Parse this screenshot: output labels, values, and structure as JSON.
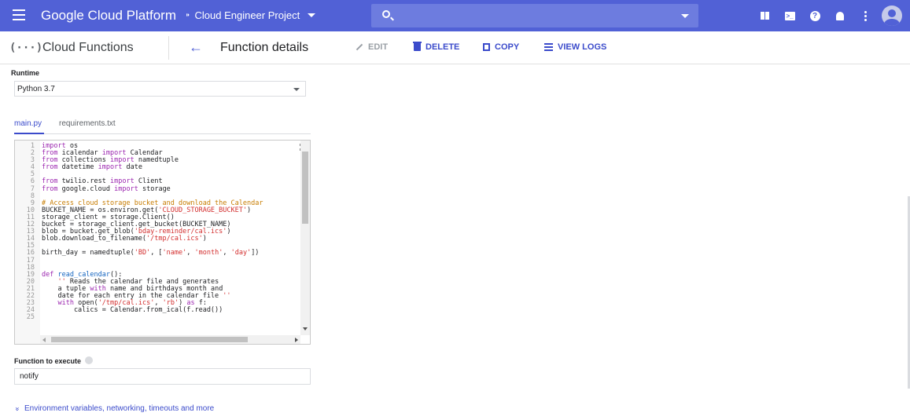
{
  "topbar": {
    "brand": "Google Cloud Platform",
    "project_icon": "project-dots-icon",
    "project": "Cloud Engineer Project",
    "search_placeholder": "",
    "accent": "#5161d6",
    "icons": [
      "gift-icon",
      "cloud-shell-icon",
      "help-icon",
      "notifications-icon",
      "more-vert-icon",
      "account-avatar"
    ]
  },
  "subbar": {
    "product_logo": "(···)",
    "product": "Cloud Functions",
    "page_title": "Function details",
    "actions": {
      "edit": "EDIT",
      "delete": "DELETE",
      "copy": "COPY",
      "view_logs": "VIEW LOGS"
    }
  },
  "runtime": {
    "label": "Runtime",
    "value": "Python 3.7"
  },
  "tabs": [
    {
      "label": "main.py",
      "active": true
    },
    {
      "label": "requirements.txt",
      "active": false
    }
  ],
  "code": [
    "import os",
    "from icalendar import Calendar",
    "from collections import namedtuple",
    "from datetime import date",
    "",
    "from twilio.rest import Client",
    "from google.cloud import storage",
    "",
    "# Access cloud storage bucket and download the Calendar",
    "BUCKET_NAME = os.environ.get('CLOUD_STORAGE_BUCKET')",
    "storage_client = storage.Client()",
    "bucket = storage_client.get_bucket(BUCKET_NAME)",
    "blob = bucket.get_blob('bday-reminder/cal.ics')",
    "blob.download_to_filename('/tmp/cal.ics')",
    "",
    "birth_day = namedtuple('BD', ['name', 'month', 'day'])",
    "",
    "",
    "def read_calendar():",
    "    ''' Reads the calendar file and generates",
    "    a tuple with name and birthday's month and",
    "    date for each entry in the calendar file '''",
    "    with open('/tmp/cal.ics', 'rb') as f:",
    "        calics = Calendar.from_ical(f.read())",
    ""
  ],
  "function_to_execute": {
    "label": "Function to execute",
    "value": "notify"
  },
  "env_link": "Environment variables, networking, timeouts and more"
}
